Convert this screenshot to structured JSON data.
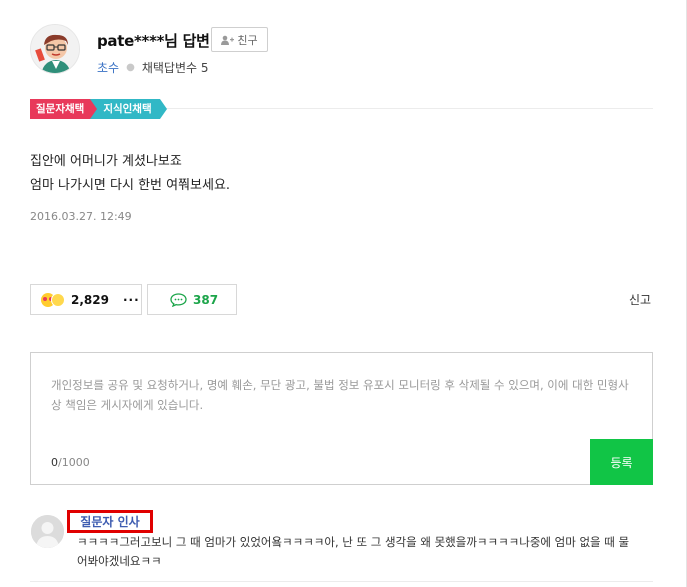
{
  "answer": {
    "author_name": "pate****님 답변",
    "friend_button_label": "친구",
    "grade": "초수",
    "adopt_count_label": "채택답변수 5",
    "badges": {
      "asker_adopted": "질문자채택",
      "jisik_adopted": "지식인채택"
    },
    "body_lines": [
      "집안에 어머니가 계셨나보죠",
      "엄마 나가시면 다시 한번 여쭤보세요."
    ],
    "date": "2016.03.27. 12:49",
    "reaction_count": "2,829",
    "more_label": "···",
    "comment_count": "387",
    "report_label": "신고"
  },
  "comment_form": {
    "placeholder": "개인정보를 공유 및 요청하거나, 명예 훼손, 무단 광고, 불법 정보 유포시 모니터링 후 삭제될 수 있으며, 이에 대한 민형사상 책임은 게시자에게 있습니다.",
    "char_current": "0",
    "char_max": "/1000",
    "submit_label": "등록"
  },
  "reply": {
    "author": "질문자 인사",
    "text": "ㅋㅋㅋㅋ그러고보니 그 때 엄마가 있었어욬ㅋㅋㅋㅋ아, 난 또 그 생각을 왜 못했을까ㅋㅋㅋㅋ나중에 엄마 없을 때 물어봐야겠네요ㅋㅋ"
  },
  "colors": {
    "asker_badge": "#e8395a",
    "jisik_badge": "#31b8c6",
    "submit_green": "#11c546",
    "comment_count_green": "#1ca54a",
    "grade_blue": "#3b73c5",
    "highlight_red": "#e00000"
  },
  "icons": {
    "avatar": "cartoon-avatar",
    "friend": "add-person-icon",
    "reaction": "emoji-reaction-icon",
    "comment": "speech-bubble-icon"
  }
}
